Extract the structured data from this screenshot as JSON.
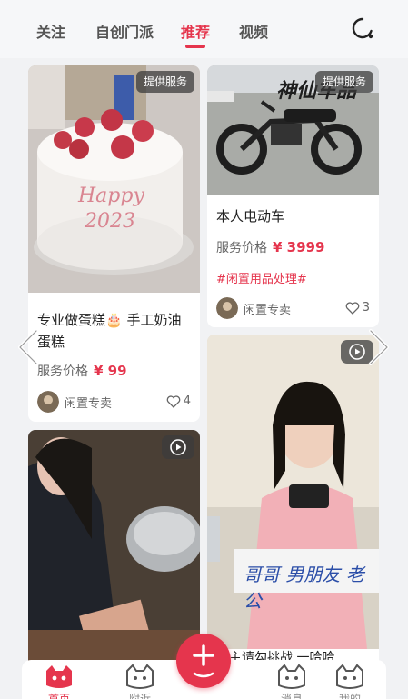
{
  "top_nav": {
    "tabs": [
      {
        "label": "关注"
      },
      {
        "label": "自创门派"
      },
      {
        "label": "推荐",
        "active": true
      },
      {
        "label": "视频"
      }
    ]
  },
  "cards": {
    "cake": {
      "badge": "提供服务",
      "title": "专业做蛋糕🎂 手工奶油蛋糕",
      "price_label": "服务价格",
      "price": "¥ 99",
      "user": "闲置专卖",
      "likes": "4"
    },
    "ebike": {
      "badge": "提供服务",
      "overlay_text": "神仙车品",
      "title": "本人电动车",
      "price_label": "服务价格",
      "price": "¥ 3999",
      "tag": "#闲置用品处理#",
      "user": "闲置专卖",
      "likes": "3"
    },
    "video_left": {
      "type": "video"
    },
    "video_right": {
      "type": "video",
      "sign_text": "哥哥 男朋友 老公",
      "title": "公主请勾挑战 一哈哈"
    }
  },
  "bottom_nav": {
    "items": [
      {
        "label": "首页",
        "active": true
      },
      {
        "label": "附近"
      },
      {
        "label": "消息"
      },
      {
        "label": "我的"
      }
    ]
  },
  "colors": {
    "accent": "#e5354d",
    "background": "#f1f2f4"
  }
}
